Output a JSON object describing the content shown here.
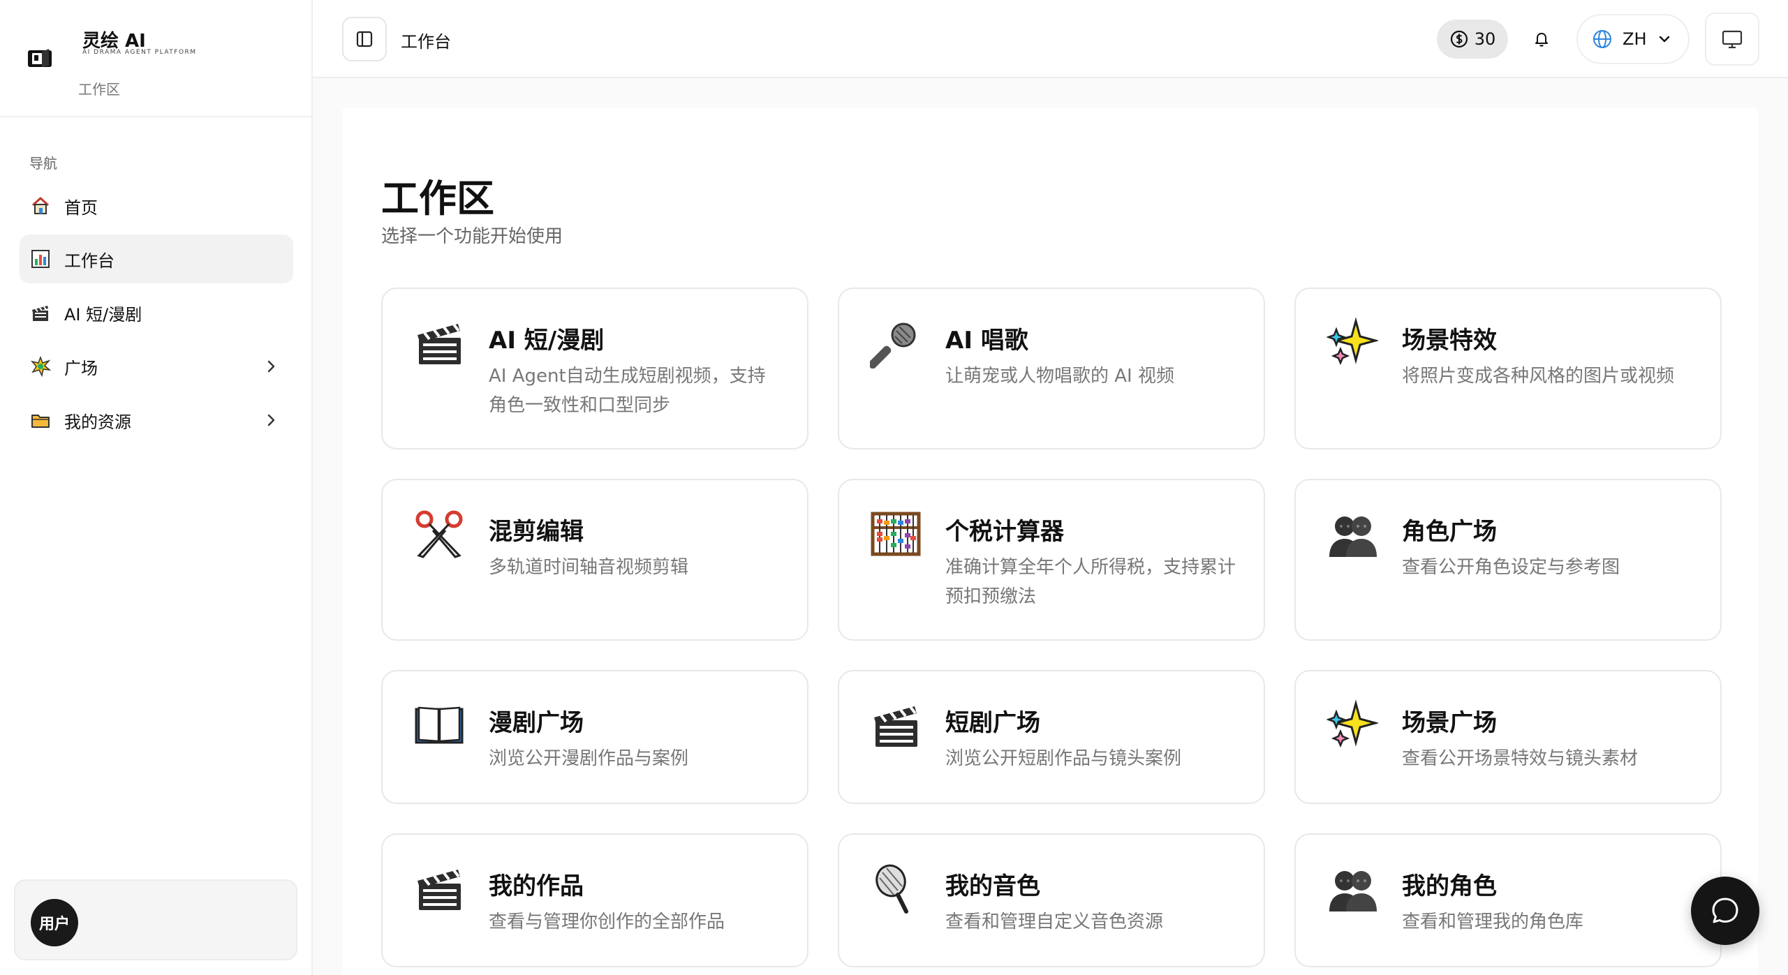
{
  "brand": {
    "title": "灵绘 AI",
    "subtitle": "AI DRAMA AGENT PLATFORM",
    "section": "工作区"
  },
  "sidebar": {
    "heading": "导航",
    "items": [
      {
        "label": "首页",
        "icon": "house-icon"
      },
      {
        "label": "工作台",
        "icon": "bar-chart-icon",
        "active": true
      },
      {
        "label": "AI 短/漫剧",
        "icon": "clapper-icon"
      },
      {
        "label": "广场",
        "icon": "sparkle-burst-icon",
        "expandable": true
      },
      {
        "label": "我的资源",
        "icon": "folder-icon",
        "expandable": true
      }
    ]
  },
  "user": {
    "avatar_label": "用户"
  },
  "topbar": {
    "breadcrumb": "工作台",
    "credits": "30",
    "language": "ZH"
  },
  "main": {
    "title": "工作区",
    "subtitle": "选择一个功能开始使用",
    "cards": [
      {
        "title": "AI 短/漫剧",
        "desc": "AI Agent自动生成短剧视频，支持角色一致性和口型同步",
        "icon": "clapper-icon"
      },
      {
        "title": "AI 唱歌",
        "desc": "让萌宠或人物唱歌的 AI 视频",
        "icon": "microphone-icon"
      },
      {
        "title": "场景特效",
        "desc": "将照片变成各种风格的图片或视频",
        "icon": "sparkles-icon"
      },
      {
        "title": "混剪编辑",
        "desc": "多轨道时间轴音视频剪辑",
        "icon": "scissors-icon"
      },
      {
        "title": "个税计算器",
        "desc": "准确计算全年个人所得税，支持累计预扣预缴法",
        "icon": "abacus-icon"
      },
      {
        "title": "角色广场",
        "desc": "查看公开角色设定与参考图",
        "icon": "people-icon"
      },
      {
        "title": "漫剧广场",
        "desc": "浏览公开漫剧作品与案例",
        "icon": "book-icon"
      },
      {
        "title": "短剧广场",
        "desc": "浏览公开短剧作品与镜头案例",
        "icon": "clapper-icon"
      },
      {
        "title": "场景广场",
        "desc": "查看公开场景特效与镜头素材",
        "icon": "sparkles-icon"
      },
      {
        "title": "我的作品",
        "desc": "查看与管理你创作的全部作品",
        "icon": "clapper-icon"
      },
      {
        "title": "我的音色",
        "desc": "查看和管理自定义音色资源",
        "icon": "studio-mic-icon"
      },
      {
        "title": "我的角色",
        "desc": "查看和管理我的角色库",
        "icon": "people-icon"
      }
    ]
  }
}
